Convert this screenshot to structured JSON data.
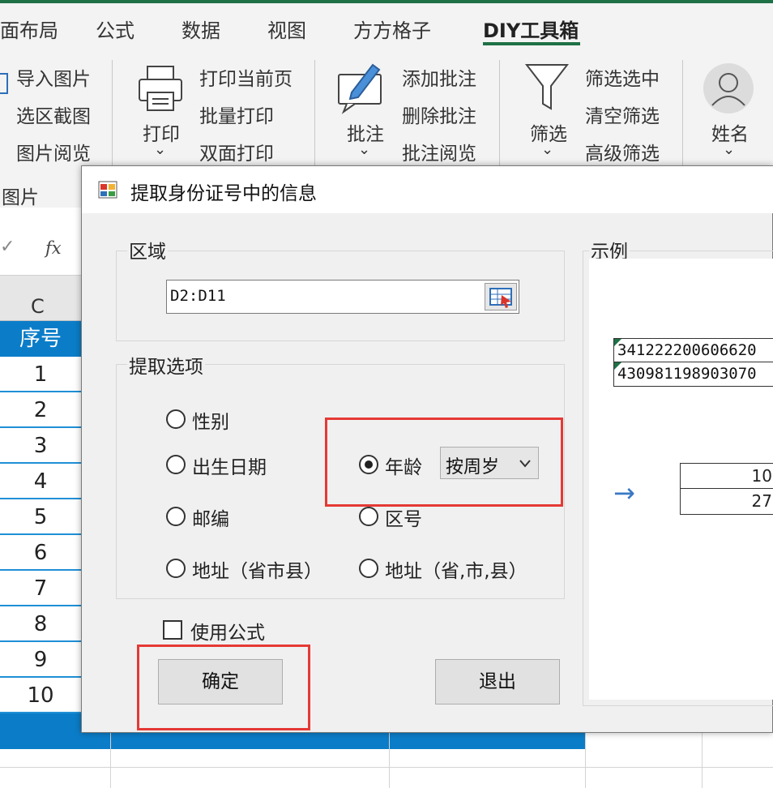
{
  "ribbon": {
    "tabs": [
      "面布局",
      "公式",
      "数据",
      "视图",
      "方方格子",
      "DIY工具箱"
    ],
    "image_group": {
      "items": [
        "导入图片",
        "选区截图",
        "图片阅览"
      ],
      "footer": "图片"
    },
    "print_group": {
      "big_label": "打印",
      "items": [
        "打印当前页",
        "批量打印",
        "双面打印"
      ]
    },
    "comment_group": {
      "big_label": "批注",
      "items": [
        "添加批注",
        "删除批注",
        "批注阅览"
      ]
    },
    "filter_group": {
      "big_label": "筛选",
      "items": [
        "筛选选中",
        "清空筛选",
        "高级筛选"
      ]
    },
    "name_group": {
      "big_label": "姓名"
    },
    "dropdown_glyph": "⌄"
  },
  "sheet": {
    "fx_label": "fx",
    "col_c": "C",
    "header_cell": "序号",
    "rows": [
      "1",
      "2",
      "3",
      "4",
      "5",
      "6",
      "7",
      "8",
      "9",
      "10"
    ]
  },
  "dialog": {
    "title": "提取身份证号中的信息",
    "range_group": {
      "label": "区域",
      "value": "D2:D11"
    },
    "options_group": {
      "label": "提取选项",
      "options": [
        {
          "label": "性别",
          "checked": false
        },
        {
          "label": "出生日期",
          "checked": false
        },
        {
          "label": "年龄",
          "checked": true
        },
        {
          "label": "邮编",
          "checked": false
        },
        {
          "label": "区号",
          "checked": false
        },
        {
          "label": "地址（省市县）",
          "checked": false
        },
        {
          "label": "地址（省,市,县）",
          "checked": false
        }
      ],
      "age_mode": "按周岁"
    },
    "use_formula": {
      "label": "使用公式",
      "checked": false
    },
    "ok_label": "确定",
    "exit_label": "退出",
    "example": {
      "label": "示例",
      "ids": [
        "341222200606620",
        "430981198903070"
      ],
      "results": [
        "10",
        "27"
      ],
      "arrow": "→"
    }
  },
  "colors": {
    "excel_green": "#1e7145",
    "header_blue": "#0b7dc8",
    "highlight_red": "#e53935"
  }
}
